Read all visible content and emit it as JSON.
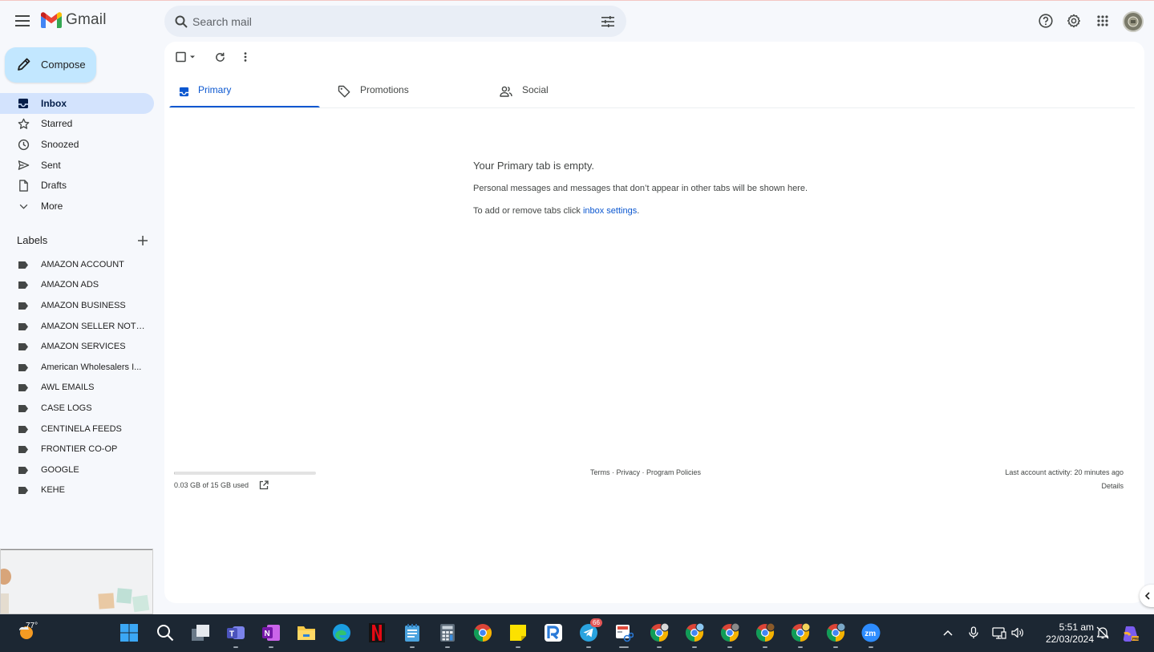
{
  "app": {
    "name": "Gmail"
  },
  "search": {
    "placeholder": "Search mail"
  },
  "compose": {
    "label": "Compose"
  },
  "nav": [
    {
      "label": "Inbox",
      "icon": "inbox-icon",
      "active": true
    },
    {
      "label": "Starred",
      "icon": "star-icon"
    },
    {
      "label": "Snoozed",
      "icon": "clock-icon"
    },
    {
      "label": "Sent",
      "icon": "send-icon"
    },
    {
      "label": "Drafts",
      "icon": "draft-icon"
    },
    {
      "label": "More",
      "icon": "chevron-down-icon"
    }
  ],
  "labels": {
    "heading": "Labels",
    "items": [
      "AMAZON ACCOUNT",
      "AMAZON ADS",
      "AMAZON BUSINESS",
      "AMAZON SELLER NOTIF...",
      "AMAZON SERVICES",
      "American Wholesalers I...",
      "AWL EMAILS",
      "CASE LOGS",
      "CENTINELA FEEDS",
      "FRONTIER CO-OP",
      "GOOGLE",
      "KEHE"
    ]
  },
  "tabs": [
    {
      "label": "Primary",
      "icon": "inbox-icon",
      "active": true
    },
    {
      "label": "Promotions",
      "icon": "tag-icon"
    },
    {
      "label": "Social",
      "icon": "people-icon"
    }
  ],
  "empty": {
    "title": "Your Primary tab is empty.",
    "line1": "Personal messages and messages that don’t appear in other tabs will be shown here.",
    "line2_prefix": "To add or remove tabs click ",
    "line2_link": "inbox settings",
    "line2_suffix": "."
  },
  "footer": {
    "storage_text": "0.03 GB of 15 GB used",
    "storage_used_fraction": 0.002,
    "terms": "Terms",
    "privacy": "Privacy",
    "policies": "Program Policies",
    "sep": " · ",
    "activity": "Last account activity: 20 minutes ago",
    "details": "Details"
  },
  "taskbar": {
    "weather_temp": "77°",
    "telegram_badge": "66",
    "time": "5:51 am",
    "date": "22/03/2024",
    "apps": [
      "windows-start-icon",
      "search-icon",
      "task-view-icon",
      "teams-icon",
      "onenote-icon",
      "file-explorer-icon",
      "edge-icon",
      "netflix-icon",
      "notepad-icon",
      "calculator-icon",
      "chrome-icon",
      "sticky-notes-icon",
      "rustdesk-icon",
      "telegram-icon",
      "snipping-tool-icon",
      "chrome-profile-icon",
      "chrome-profile-icon",
      "chrome-profile-icon",
      "chrome-profile-icon",
      "chrome-profile-icon",
      "chrome-profile-icon",
      "zoom-icon"
    ]
  },
  "colors": {
    "accent": "#0b57d0",
    "compose_bg": "#c2e7ff",
    "active_nav": "#d3e3fd",
    "page_bg": "#f6f8fc",
    "taskbar": "#1c2733"
  }
}
